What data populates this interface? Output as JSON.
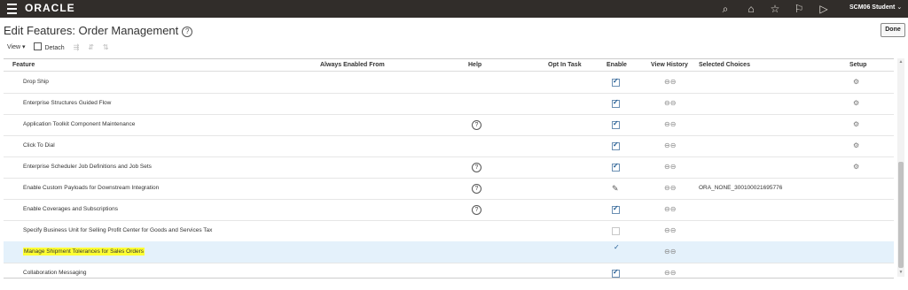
{
  "header": {
    "brand": "ORACLE",
    "user": "SCM06 Student",
    "icons": [
      "search-icon",
      "home-icon",
      "favorites-icon",
      "flag-icon",
      "notifications-icon"
    ]
  },
  "page": {
    "title": "Edit Features: Order Management",
    "done_label": "Done"
  },
  "toolbar": {
    "view_label": "View",
    "detach_label": "Detach"
  },
  "columns": {
    "feature": "Feature",
    "always_enabled_from": "Always Enabled From",
    "help": "Help",
    "opt_in_task": "Opt In Task",
    "enable": "Enable",
    "view_history": "View History",
    "selected_choices": "Selected Choices",
    "setup": "Setup"
  },
  "rows": [
    {
      "feature": "Drop Ship",
      "help": false,
      "enable": "checked",
      "choice": "",
      "setup": true
    },
    {
      "feature": "Enterprise Structures Guided Flow",
      "help": false,
      "enable": "checked",
      "choice": "",
      "setup": true
    },
    {
      "feature": "Application Toolkit Component Maintenance",
      "help": true,
      "enable": "checked",
      "choice": "",
      "setup": true
    },
    {
      "feature": "Click To Dial",
      "help": false,
      "enable": "checked",
      "choice": "",
      "setup": true
    },
    {
      "feature": "Enterprise Scheduler Job Definitions and Job Sets",
      "help": true,
      "enable": "checked",
      "choice": "",
      "setup": true
    },
    {
      "feature": "Enable Custom Payloads for Downstream Integration",
      "help": true,
      "enable": "edit",
      "choice": "ORA_NONE_300100021695776",
      "setup": false
    },
    {
      "feature": "Enable Coverages and Subscriptions",
      "help": true,
      "enable": "checked",
      "choice": "",
      "setup": false
    },
    {
      "feature": "Specify Business Unit for Selling Profit Center for Goods and Services Tax",
      "help": false,
      "enable": "unchecked",
      "choice": "",
      "setup": false
    },
    {
      "feature": "Manage Shipment Tolerances for Sales Orders",
      "help": false,
      "enable": "tick",
      "choice": "",
      "setup": false,
      "selected": true,
      "highlighted": true
    },
    {
      "feature": "Collaboration Messaging",
      "help": false,
      "enable": "checked",
      "choice": "",
      "setup": false
    }
  ],
  "colors": {
    "topbar": "#312d2a",
    "selected_row": "#e4f1fb",
    "highlight": "#ffff33",
    "checkbox": "#1f5a91"
  }
}
